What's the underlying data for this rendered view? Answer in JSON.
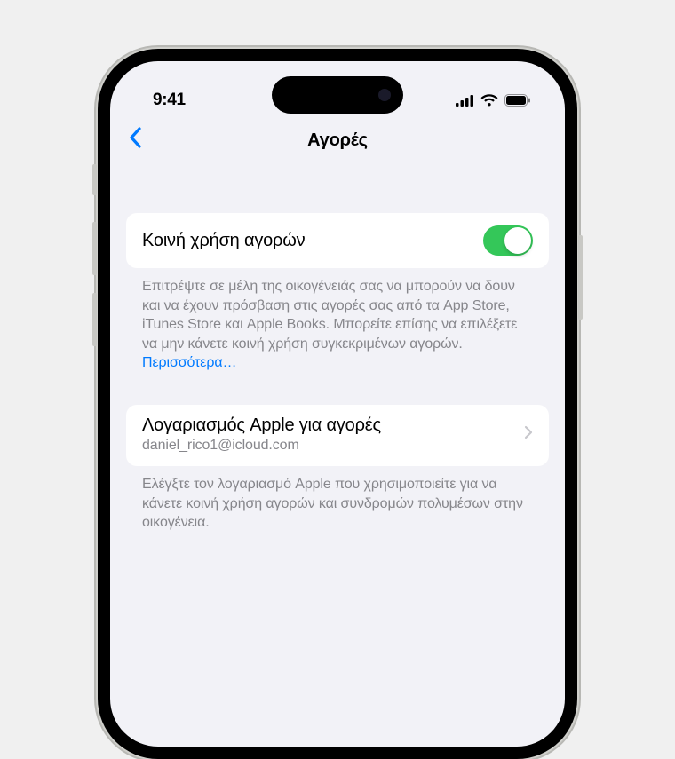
{
  "statusBar": {
    "time": "9:41"
  },
  "nav": {
    "title": "Αγορές"
  },
  "shareRow": {
    "title": "Κοινή χρήση αγορών",
    "footer": "Επιτρέψτε σε μέλη της οικογένειάς σας να μπορούν να δουν και να έχουν πρόσβαση στις αγορές σας από τα App Store, iTunes Store και Apple Books. Μπορείτε επίσης να επιλέξετε να μην κάνετε κοινή χρήση συγκεκριμένων αγορών. ",
    "moreLink": "Περισσότερα…",
    "toggleOn": true
  },
  "accountRow": {
    "title": "Λογαριασμός Apple για αγορές",
    "subtitle": "daniel_rico1@icloud.com",
    "footer": "Ελέγξτε τον λογαριασμό Apple που χρησιμοποιείτε για να κάνετε κοινή χρήση αγορών και συνδρομών πολυμέσων στην οικογένεια."
  }
}
